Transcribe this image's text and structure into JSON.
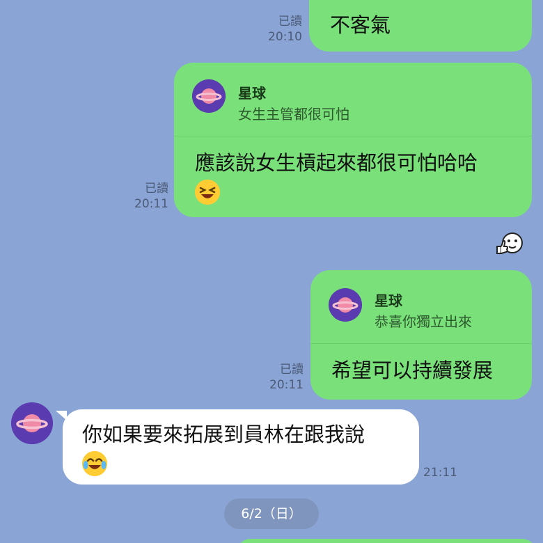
{
  "messages": [
    {
      "read": "已讀",
      "time": "20:10",
      "text": "不客氣"
    },
    {
      "read": "已讀",
      "time": "20:11",
      "reply_to_name": "星球",
      "reply_to_text": "女生主管都很可怕",
      "text": "應該說女生槓起來都很可怕哈哈"
    },
    {
      "read": "已讀",
      "time": "20:11",
      "reply_to_name": "星球",
      "reply_to_text": "恭喜你獨立出來",
      "text": "希望可以持續發展"
    },
    {
      "time": "21:11",
      "text": "你如果要來拓展到員林在跟我說"
    }
  ],
  "date_separator": "6/2（日）",
  "icons": {
    "avatar": "planet-avatar-icon",
    "emoji_laugh": "laughing-squint-emoji",
    "emoji_tears": "tears-of-joy-emoji",
    "sticker": "thumbs-up-face-sticker-icon"
  },
  "colors": {
    "background": "#8aa5d5",
    "outgoing_bubble": "#79e07a",
    "incoming_bubble": "#ffffff",
    "date_pill": "#7f95bd"
  }
}
